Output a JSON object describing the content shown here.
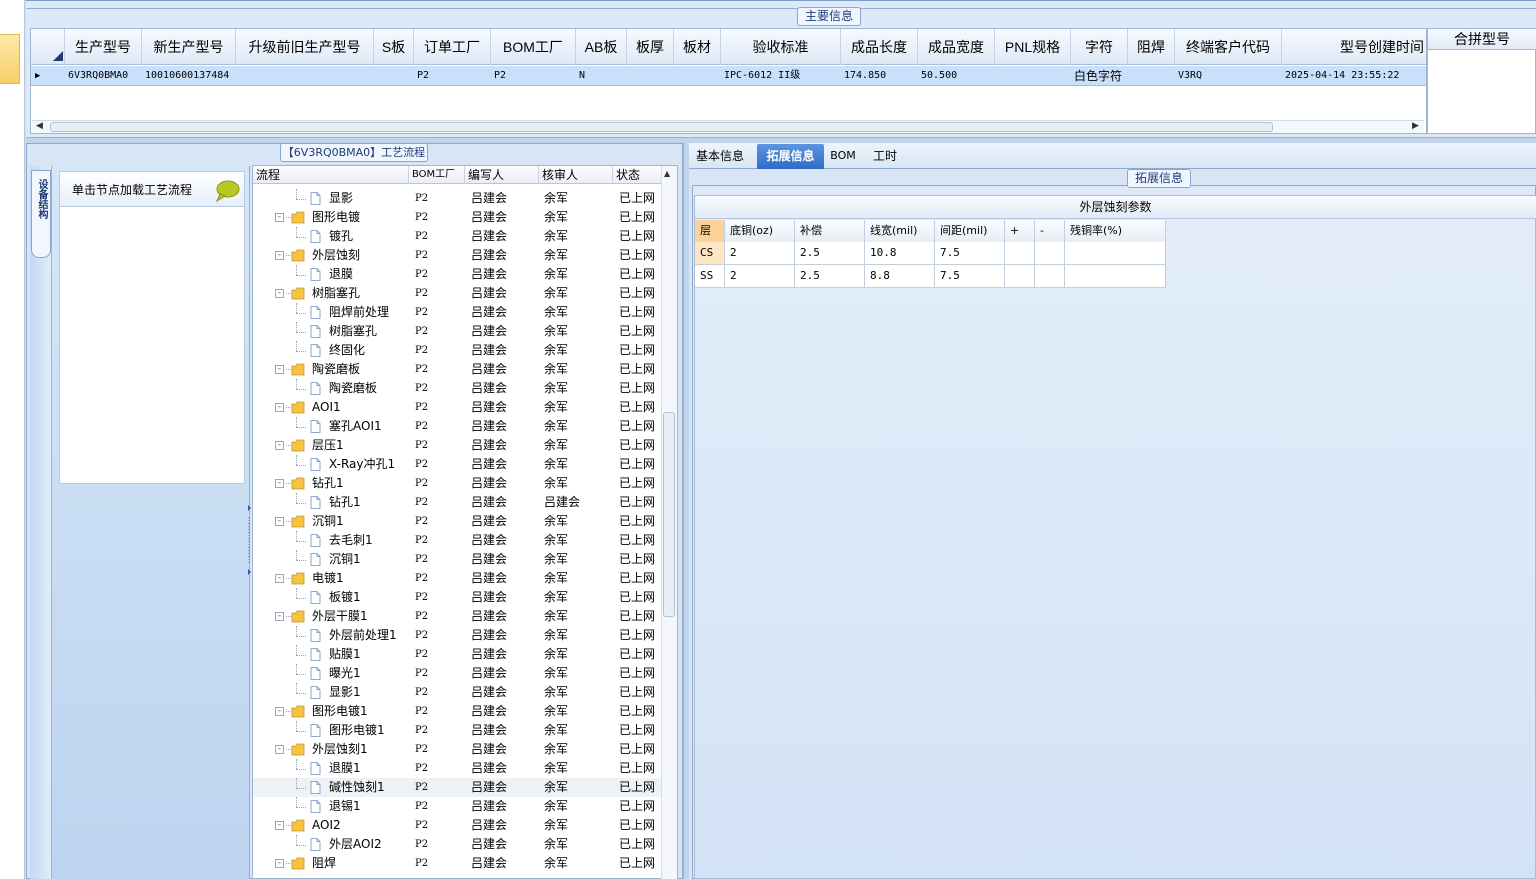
{
  "top_panel": {
    "group_title": "主要信息",
    "columns": [
      "生产型号",
      "新生产型号",
      "升级前旧生产型号",
      "S板",
      "订单工厂",
      "BOM工厂",
      "AB板",
      "板厚",
      "板材",
      "验收标准",
      "成品长度",
      "成品宽度",
      "PNL规格",
      "字符",
      "阻焊",
      "终端客户代码",
      "型号创建时间"
    ],
    "row": [
      "6V3RQ0BMA0",
      "10010600137484",
      "",
      "",
      "P2",
      "P2",
      "N",
      "",
      "",
      "IPC-6012 II级",
      "174.850",
      "50.500",
      "",
      "白色字符",
      "",
      "V3RQ",
      "2025-04-14 23:55:22"
    ],
    "merge_header": "合拼型号"
  },
  "left_panel": {
    "group_title": "【6V3RQ0BMA0】工艺流程",
    "vertical_tab": "设备结构",
    "nav_hint": "单击节点加载工艺流程"
  },
  "tree": {
    "headers": [
      "流程",
      "BOM工厂",
      "编写人",
      "核审人",
      "状态"
    ],
    "rows": [
      {
        "label": "显影",
        "bom": "P2",
        "writer": "吕建会",
        "reviewer": "余军",
        "status": "已上网"
      },
      {
        "label": "图形电镀",
        "bom": "P2",
        "writer": "吕建会",
        "reviewer": "余军",
        "status": "已上网"
      },
      {
        "label": "镀孔",
        "bom": "P2",
        "writer": "吕建会",
        "reviewer": "余军",
        "status": "已上网"
      },
      {
        "label": "外层蚀刻",
        "bom": "P2",
        "writer": "吕建会",
        "reviewer": "余军",
        "status": "已上网"
      },
      {
        "label": "退膜",
        "bom": "P2",
        "writer": "吕建会",
        "reviewer": "余军",
        "status": "已上网"
      },
      {
        "label": "树脂塞孔",
        "bom": "P2",
        "writer": "吕建会",
        "reviewer": "余军",
        "status": "已上网"
      },
      {
        "label": "阻焊前处理",
        "bom": "P2",
        "writer": "吕建会",
        "reviewer": "余军",
        "status": "已上网"
      },
      {
        "label": "树脂塞孔",
        "bom": "P2",
        "writer": "吕建会",
        "reviewer": "余军",
        "status": "已上网"
      },
      {
        "label": "终固化",
        "bom": "P2",
        "writer": "吕建会",
        "reviewer": "余军",
        "status": "已上网"
      },
      {
        "label": "陶瓷磨板",
        "bom": "P2",
        "writer": "吕建会",
        "reviewer": "余军",
        "status": "已上网"
      },
      {
        "label": "陶瓷磨板",
        "bom": "P2",
        "writer": "吕建会",
        "reviewer": "余军",
        "status": "已上网"
      },
      {
        "label": "AOI1",
        "bom": "P2",
        "writer": "吕建会",
        "reviewer": "余军",
        "status": "已上网"
      },
      {
        "label": "塞孔AOI1",
        "bom": "P2",
        "writer": "吕建会",
        "reviewer": "余军",
        "status": "已上网"
      },
      {
        "label": "层压1",
        "bom": "P2",
        "writer": "吕建会",
        "reviewer": "余军",
        "status": "已上网"
      },
      {
        "label": "X-Ray冲孔1",
        "bom": "P2",
        "writer": "吕建会",
        "reviewer": "余军",
        "status": "已上网"
      },
      {
        "label": "钻孔1",
        "bom": "P2",
        "writer": "吕建会",
        "reviewer": "余军",
        "status": "已上网"
      },
      {
        "label": "钻孔1",
        "bom": "P2",
        "writer": "吕建会",
        "reviewer": "吕建会",
        "status": "已上网"
      },
      {
        "label": "沉铜1",
        "bom": "P2",
        "writer": "吕建会",
        "reviewer": "余军",
        "status": "已上网"
      },
      {
        "label": "去毛刺1",
        "bom": "P2",
        "writer": "吕建会",
        "reviewer": "余军",
        "status": "已上网"
      },
      {
        "label": "沉铜1",
        "bom": "P2",
        "writer": "吕建会",
        "reviewer": "余军",
        "status": "已上网"
      },
      {
        "label": "电镀1",
        "bom": "P2",
        "writer": "吕建会",
        "reviewer": "余军",
        "status": "已上网"
      },
      {
        "label": "板镀1",
        "bom": "P2",
        "writer": "吕建会",
        "reviewer": "余军",
        "status": "已上网"
      },
      {
        "label": "外层干膜1",
        "bom": "P2",
        "writer": "吕建会",
        "reviewer": "余军",
        "status": "已上网"
      },
      {
        "label": "外层前处理1",
        "bom": "P2",
        "writer": "吕建会",
        "reviewer": "余军",
        "status": "已上网"
      },
      {
        "label": "贴膜1",
        "bom": "P2",
        "writer": "吕建会",
        "reviewer": "余军",
        "status": "已上网"
      },
      {
        "label": "曝光1",
        "bom": "P2",
        "writer": "吕建会",
        "reviewer": "余军",
        "status": "已上网"
      },
      {
        "label": "显影1",
        "bom": "P2",
        "writer": "吕建会",
        "reviewer": "余军",
        "status": "已上网"
      },
      {
        "label": "图形电镀1",
        "bom": "P2",
        "writer": "吕建会",
        "reviewer": "余军",
        "status": "已上网"
      },
      {
        "label": "图形电镀1",
        "bom": "P2",
        "writer": "吕建会",
        "reviewer": "余军",
        "status": "已上网"
      },
      {
        "label": "外层蚀刻1",
        "bom": "P2",
        "writer": "吕建会",
        "reviewer": "余军",
        "status": "已上网"
      },
      {
        "label": "退膜1",
        "bom": "P2",
        "writer": "吕建会",
        "reviewer": "余军",
        "status": "已上网"
      },
      {
        "label": "碱性蚀刻1",
        "bom": "P2",
        "writer": "吕建会",
        "reviewer": "余军",
        "status": "已上网"
      },
      {
        "label": "退锡1",
        "bom": "P2",
        "writer": "吕建会",
        "reviewer": "余军",
        "status": "已上网"
      },
      {
        "label": "AOI2",
        "bom": "P2",
        "writer": "吕建会",
        "reviewer": "余军",
        "status": "已上网"
      },
      {
        "label": "外层AOI2",
        "bom": "P2",
        "writer": "吕建会",
        "reviewer": "余军",
        "status": "已上网"
      },
      {
        "label": "阻焊",
        "bom": "P2",
        "writer": "吕建会",
        "reviewer": "余军",
        "status": "已上网"
      }
    ]
  },
  "right_panel": {
    "tabs": [
      "基本信息",
      "拓展信息",
      "BOM",
      "工时"
    ],
    "active_tab": "拓展信息",
    "group_title": "拓展信息",
    "table_title": "外层蚀刻参数",
    "headers": [
      "层",
      "底铜(oz)",
      "补偿",
      "线宽(mil)",
      "间距(mil)",
      "+",
      "-",
      "残铜率(%)"
    ],
    "rows": [
      [
        "CS",
        "2",
        "2.5",
        "10.8",
        "7.5",
        "",
        "",
        ""
      ],
      [
        "SS",
        "2",
        "2.5",
        "8.8",
        "7.5",
        "",
        "",
        ""
      ]
    ]
  },
  "colors": {
    "accent_tab": "#2f6cc7",
    "selected_row": "#c9e0fb",
    "folder": "#f6c343"
  }
}
